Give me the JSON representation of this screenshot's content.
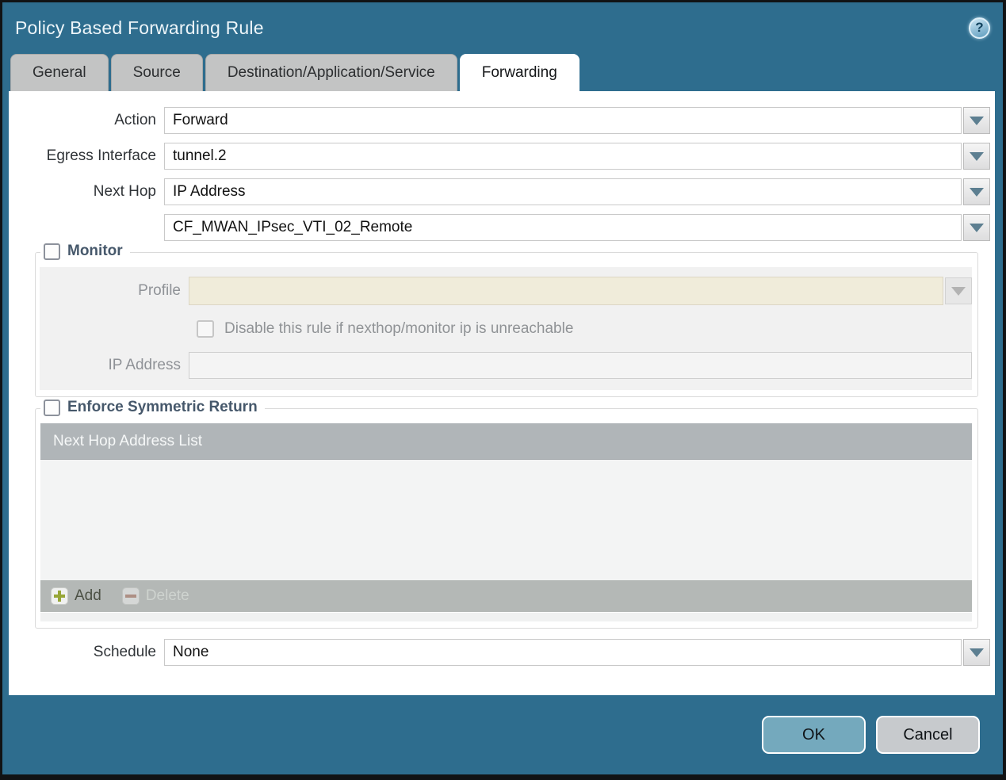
{
  "dialog": {
    "title": "Policy Based Forwarding Rule",
    "help_glyph": "?"
  },
  "tabs": [
    {
      "label": "General",
      "active": false
    },
    {
      "label": "Source",
      "active": false
    },
    {
      "label": "Destination/Application/Service",
      "active": false
    },
    {
      "label": "Forwarding",
      "active": true
    }
  ],
  "form": {
    "action": {
      "label": "Action",
      "value": "Forward"
    },
    "egress_interface": {
      "label": "Egress Interface",
      "value": "tunnel.2"
    },
    "next_hop": {
      "label": "Next Hop",
      "value": "IP Address"
    },
    "next_hop_address": {
      "value": "CF_MWAN_IPsec_VTI_02_Remote"
    },
    "schedule": {
      "label": "Schedule",
      "value": "None"
    }
  },
  "monitor": {
    "legend": "Monitor",
    "checked": false,
    "profile": {
      "label": "Profile",
      "value": ""
    },
    "disable_rule_checkbox": {
      "label": "Disable this rule if nexthop/monitor ip is unreachable",
      "checked": false
    },
    "ip_address": {
      "label": "IP Address",
      "value": ""
    }
  },
  "enforce_symmetric_return": {
    "legend": "Enforce Symmetric Return",
    "checked": false,
    "table": {
      "header": "Next Hop Address List",
      "rows": []
    },
    "add_label": "Add",
    "delete_label": "Delete",
    "delete_enabled": false
  },
  "footer": {
    "ok_label": "OK",
    "cancel_label": "Cancel"
  },
  "colors": {
    "titlebar_teal": "#2e6d8e",
    "ok_button": "#74a9bd",
    "cancel_button": "#c7cacd",
    "table_header_gray": "#b0b5b8",
    "legend_text": "#46586b",
    "profile_disabled_bg": "#f0ecda",
    "add_plus_green": "#97a637",
    "delete_minus_red": "#a96f5c",
    "dropdown_arrow": "#5d7f91"
  }
}
